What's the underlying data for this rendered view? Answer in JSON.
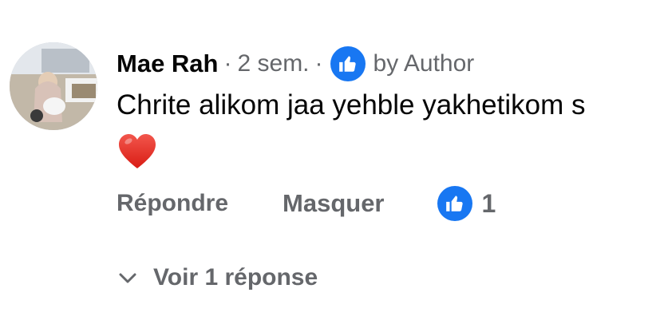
{
  "comment": {
    "author": "Mae Rah",
    "separator": "·",
    "time": "2 sem.",
    "author_reaction": "by Author",
    "text": "Chrite alikom jaa yehble yakhetikom s",
    "reaction_emoji": "heart-emoji",
    "avatar": "profile-photo"
  },
  "actions": {
    "reply_label": "Répondre",
    "hide_label": "Masquer",
    "like_count": "1"
  },
  "replies": {
    "toggle_label": "Voir 1 réponse"
  },
  "colors": {
    "text_primary": "#050505",
    "text_secondary": "#65676b",
    "like_blue": "#1877f2",
    "heart_red": "#e0241b",
    "background": "#ffffff"
  },
  "icons": {
    "like": "thumbs-up-icon",
    "heart": "heart-icon",
    "chevron": "chevron-down-icon"
  }
}
